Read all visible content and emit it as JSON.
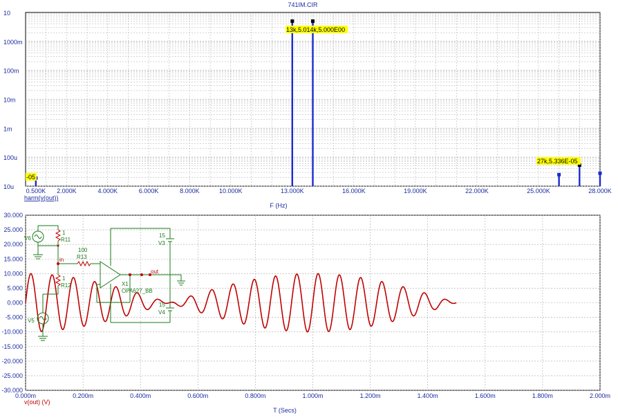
{
  "title": "741IM.CIR",
  "colors": {
    "axis_text": "#1a2aa0",
    "trace": "#c00000",
    "stem": "#1a2ad0",
    "schematic": "#1a7a1a",
    "grid": "#a8a8a8",
    "annotation_bg": "#ffff00"
  },
  "top_chart": {
    "xlabel": "F (Hz)",
    "trace_label": "harm(v(out))",
    "x_ticks": [
      "0.500K",
      "2.000K",
      "4.000K",
      "6.000K",
      "8.000K",
      "10.000K",
      "13.000K",
      "16.000K",
      "19.000K",
      "22.000K",
      "25.000K",
      "28.000K"
    ],
    "y_ticks": [
      "10",
      "1000m",
      "100m",
      "10m",
      "1m",
      "100u",
      "10u"
    ],
    "annotations": [
      "-05",
      "13k,5.014k,5.000E00",
      "27k,5.336E-05"
    ]
  },
  "bottom_chart": {
    "xlabel": "T (Secs)",
    "trace_label": "v(out) (V)",
    "x_ticks": [
      "0.000m",
      "0.200m",
      "0.400m",
      "0.600m",
      "0.800m",
      "1.000m",
      "1.200m",
      "1.400m",
      "1.600m",
      "1.800m",
      "2.000m"
    ],
    "y_ticks": [
      "30.000",
      "25.000",
      "20.000",
      "15.000",
      "10.000",
      "5.000",
      "0.000",
      "-5.000",
      "-10.000",
      "-15.000",
      "-20.000",
      "-25.000",
      "-30.000"
    ]
  },
  "schematic": {
    "labels": {
      "v6": "V6",
      "r11_val": "1",
      "r11": "R11",
      "r13_val": "100",
      "r13": "R13",
      "in": "in",
      "r12_val": "1",
      "r12": "R12",
      "v5": "V5",
      "v3_val": "15",
      "v3": "V3",
      "v4_val": "15",
      "v4": "V4",
      "out": "out",
      "x1": "X1",
      "model": "OPA627_BB"
    }
  },
  "chart_data": [
    {
      "type": "bar",
      "title": "741IM.CIR",
      "xlabel": "F (Hz)",
      "ylabel": "",
      "series": [
        {
          "name": "harm(v(out))",
          "x": [
            500,
            13000,
            14000,
            26000,
            27000,
            28000
          ],
          "values": [
            1.9e-05,
            5.0,
            5.0,
            2.5e-05,
            5.336e-05,
            2.8e-05
          ]
        }
      ],
      "x_range": [
        0,
        28000
      ],
      "ylim": [
        1e-05,
        10
      ],
      "y_scale": "log",
      "grid": true
    },
    {
      "type": "line",
      "xlabel": "T (Secs)",
      "ylabel": "",
      "series": [
        {
          "name": "v(out) (V)",
          "description_values": "beat waveform: 10V amplitude envelope from 13kHz + 14kHz sum",
          "x": [
            0.0,
            0.5,
            1.0,
            1.5
          ],
          "values": [
            0.0,
            0.0,
            0.0,
            0.0
          ]
        }
      ],
      "x_range_ms": [
        0,
        2
      ],
      "ylim": [
        -30,
        30
      ],
      "grid": true
    }
  ]
}
